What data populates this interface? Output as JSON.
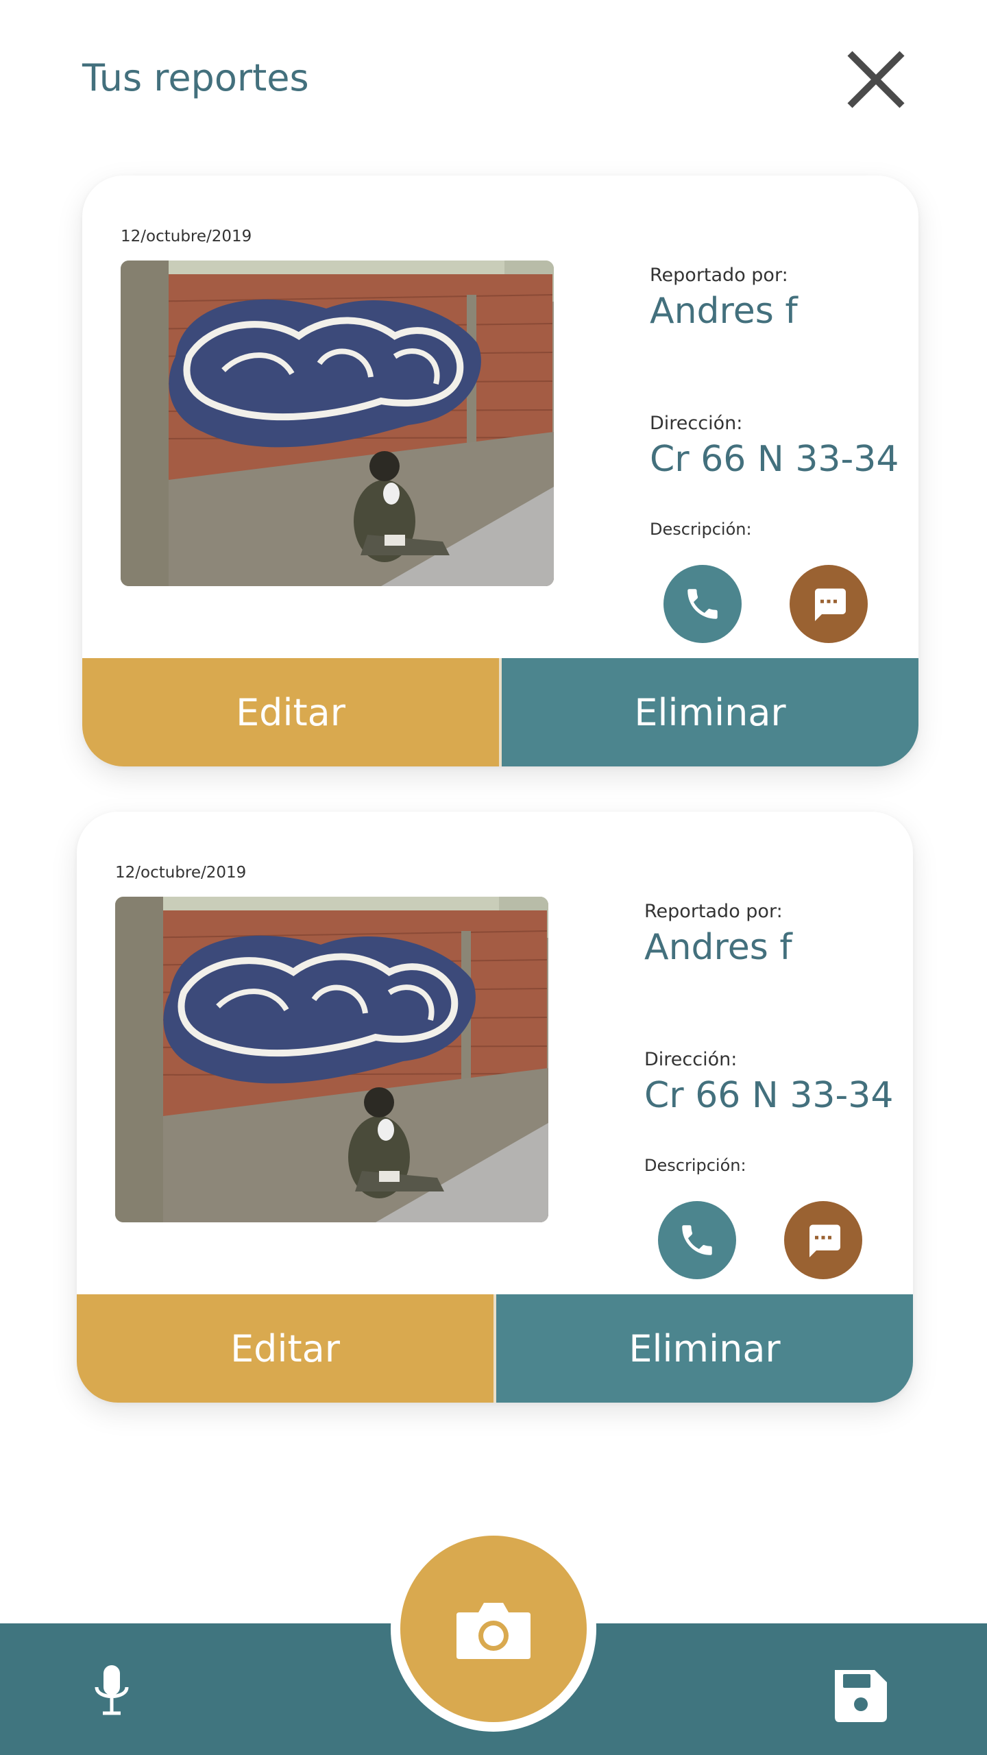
{
  "header": {
    "title": "Tus reportes"
  },
  "reports": [
    {
      "date": "12/octubre/2019",
      "reported_by_label": "Reportado por:",
      "reported_by": "Andres f",
      "address_label": "Dirección:",
      "address": "Cr 66 N 33-34",
      "description_label": "Descripción:",
      "edit_label": "Editar",
      "delete_label": "Eliminar"
    },
    {
      "date": "12/octubre/2019",
      "reported_by_label": "Reportado por:",
      "reported_by": "Andres f",
      "address_label": "Dirección:",
      "address": "Cr 66 N 33-34",
      "description_label": "Descripción:",
      "edit_label": "Editar",
      "delete_label": "Eliminar"
    }
  ],
  "icons": {
    "close": "close-icon",
    "phone": "phone-icon",
    "message": "chat-icon",
    "camera": "camera-icon",
    "mic": "microphone-icon",
    "save": "floppy-disk-icon"
  },
  "colors": {
    "teal": "#4c858e",
    "bar": "#40757f",
    "gold": "#d9a94f",
    "brown": "#9a6232",
    "title": "#43707d"
  }
}
